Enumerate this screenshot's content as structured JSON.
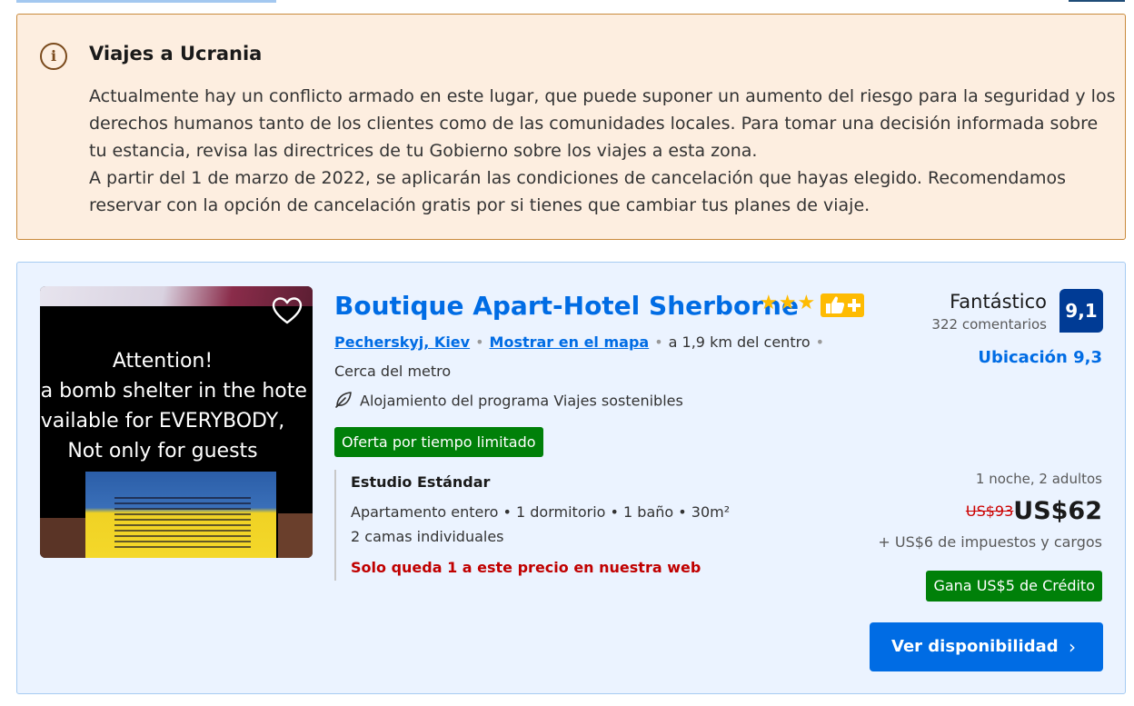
{
  "alert": {
    "icon": "info-icon",
    "title": "Viajes a Ucrania",
    "paragraph_1": "Actualmente hay un conflicto armado en este lugar, que puede suponer un aumento del riesgo para la seguridad y los derechos humanos tanto de los clientes como de las comunidades locales. Para tomar una decisión informada sobre tu estancia, revisa las directrices de tu Gobierno sobre los viajes a esta zona.",
    "paragraph_2": "A partir del 1 de marzo de 2022, se aplicarán las condiciones de cancelación que hayas elegido. Recomendamos reservar con la opción de cancelación gratis por si tienes que cambiar tus planes de viaje.",
    "background_color": "#fdeee0",
    "border_color": "#c98a3c"
  },
  "hotel": {
    "name": "Boutique Apart-Hotel Sherborne",
    "stars": "★★★",
    "star_count": 3,
    "badge_icon": "thumbs-up-plus-icon",
    "district": "Pecherskyj, Kiev",
    "map_link": "Mostrar en el mapa",
    "distance": "a 1,9 km del centro",
    "metro": "Cerca del metro",
    "sustainability": "Alojamiento del programa Viajes sostenibles",
    "offer": "Oferta por tiempo limitado",
    "photo": {
      "lines": [
        "Attention!",
        "is a bomb shelter in the hote",
        "vailable for EVERYBODY,",
        "Not only for guests"
      ],
      "favorite_icon": "heart-icon"
    }
  },
  "room": {
    "title": "Estudio Estándar",
    "description": "Apartamento entero • 1 dormitorio • 1 baño • 30m²",
    "beds": "2 camas individuales",
    "urgency": "Solo queda 1 a este precio en nuestra web"
  },
  "rating": {
    "word": "Fantástico",
    "count": "322 comentarios",
    "score": "9,1",
    "location": "Ubicación 9,3"
  },
  "pricing": {
    "occupancy": "1 noche, 2 adultos",
    "old_price": "US$93",
    "new_price": "US$62",
    "taxes": "+ US$6 de impuestos y cargos",
    "credit": "Gana US$5 de Crédito"
  },
  "cta": {
    "label": "Ver disponibilidad",
    "icon": "chevron-right-icon"
  },
  "colors": {
    "brand_blue": "#006ce4",
    "score_navy": "#003b95",
    "success_green": "#008009",
    "urgency_red": "#c00000",
    "star_yellow": "#febb02",
    "card_bg": "#ebf3ff"
  }
}
